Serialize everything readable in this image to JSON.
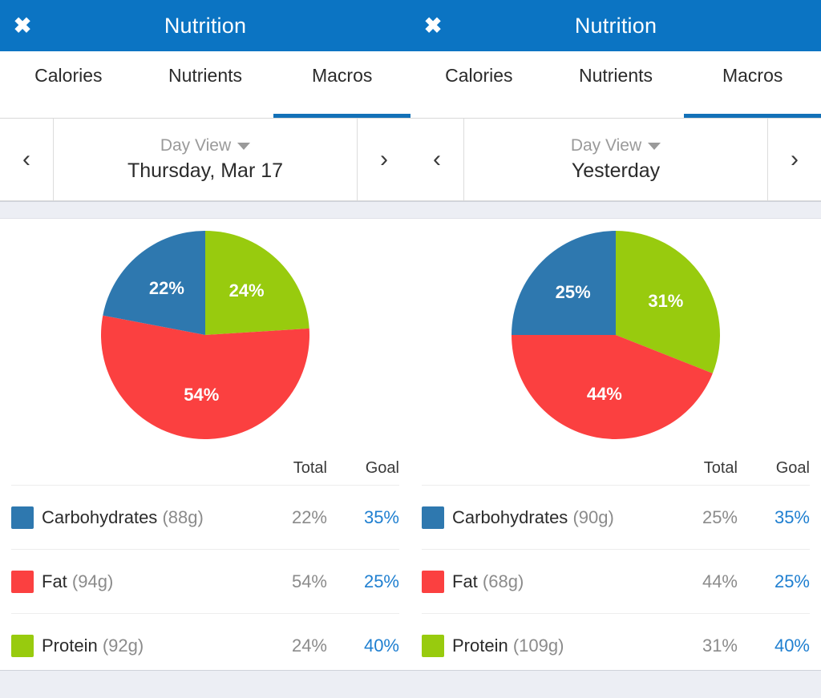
{
  "colors": {
    "header_blue": "#0b74c3",
    "accent_blue": "#1371b8",
    "carb_blue": "#2e78af",
    "fat_red": "#fb4040",
    "protein_green": "#98cb0e",
    "goal_link": "#1f7fd0",
    "band_gray": "#eceef4"
  },
  "panels": [
    {
      "header": {
        "title": "Nutrition",
        "close_icon": "close-icon"
      },
      "tabs": [
        {
          "label": "Calories",
          "active": false
        },
        {
          "label": "Nutrients",
          "active": false
        },
        {
          "label": "Macros",
          "active": true
        }
      ],
      "datebar": {
        "prev_icon": "chevron-left-icon",
        "next_icon": "chevron-right-icon",
        "view_label": "Day View",
        "caret_icon": "chevron-down-icon",
        "date_label": "Thursday, Mar 17"
      },
      "table": {
        "headers": {
          "swatch": "",
          "name": "",
          "total": "Total",
          "goal": "Goal"
        },
        "rows": [
          {
            "name": "Carbohydrates",
            "grams": "(88g)",
            "total": "22%",
            "goal": "35%",
            "color": "#2e78af"
          },
          {
            "name": "Fat",
            "grams": "(94g)",
            "total": "54%",
            "goal": "25%",
            "color": "#fb4040"
          },
          {
            "name": "Protein",
            "grams": "(92g)",
            "total": "24%",
            "goal": "40%",
            "color": "#98cb0e"
          }
        ]
      },
      "chart_data": {
        "type": "pie",
        "title": "Macros",
        "labels": [
          "Protein",
          "Fat",
          "Carbohydrates"
        ],
        "values": [
          24,
          54,
          22
        ],
        "display_labels": [
          "24%",
          "54%",
          "22%"
        ],
        "colors": [
          "#98cb0e",
          "#fb4040",
          "#2e78af"
        ],
        "start_angle_deg": 0,
        "direction": "clockwise",
        "legend": "table-below"
      }
    },
    {
      "header": {
        "title": "Nutrition",
        "close_icon": "close-icon"
      },
      "tabs": [
        {
          "label": "Calories",
          "active": false
        },
        {
          "label": "Nutrients",
          "active": false
        },
        {
          "label": "Macros",
          "active": true
        }
      ],
      "datebar": {
        "prev_icon": "chevron-left-icon",
        "next_icon": "chevron-right-icon",
        "view_label": "Day View",
        "caret_icon": "chevron-down-icon",
        "date_label": "Yesterday"
      },
      "table": {
        "headers": {
          "swatch": "",
          "name": "",
          "total": "Total",
          "goal": "Goal"
        },
        "rows": [
          {
            "name": "Carbohydrates",
            "grams": "(90g)",
            "total": "25%",
            "goal": "35%",
            "color": "#2e78af"
          },
          {
            "name": "Fat",
            "grams": "(68g)",
            "total": "44%",
            "goal": "25%",
            "color": "#fb4040"
          },
          {
            "name": "Protein",
            "grams": "(109g)",
            "total": "31%",
            "goal": "40%",
            "color": "#98cb0e"
          }
        ]
      },
      "chart_data": {
        "type": "pie",
        "title": "Macros",
        "labels": [
          "Protein",
          "Fat",
          "Carbohydrates"
        ],
        "values": [
          31,
          44,
          25
        ],
        "display_labels": [
          "31%",
          "44%",
          "25%"
        ],
        "colors": [
          "#98cb0e",
          "#fb4040",
          "#2e78af"
        ],
        "start_angle_deg": 0,
        "direction": "clockwise",
        "legend": "table-below"
      }
    }
  ]
}
